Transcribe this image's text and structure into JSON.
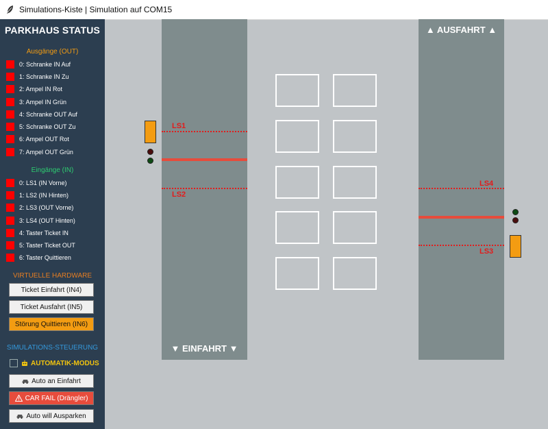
{
  "window": {
    "title": "Simulations-Kiste | Simulation auf COM15"
  },
  "sidebar": {
    "heading": "PARKHAUS STATUS",
    "outputs_title": "Ausgänge (OUT)",
    "outputs": [
      {
        "label": "0: Schranke IN Auf"
      },
      {
        "label": "1: Schranke IN Zu"
      },
      {
        "label": "2: Ampel IN Rot"
      },
      {
        "label": "3: Ampel IN Grün"
      },
      {
        "label": "4: Schranke OUT Auf"
      },
      {
        "label": "5: Schranke OUT Zu"
      },
      {
        "label": "6: Ampel OUT Rot"
      },
      {
        "label": "7: Ampel OUT Grün"
      }
    ],
    "inputs_title": "Eingänge (IN)",
    "inputs": [
      {
        "label": "0: LS1 (IN Vorne)"
      },
      {
        "label": "1: LS2 (IN Hinten)"
      },
      {
        "label": "2: LS3 (OUT Vorne)"
      },
      {
        "label": "3: LS4 (OUT Hinten)"
      },
      {
        "label": "4: Taster Ticket IN"
      },
      {
        "label": "5: Taster Ticket OUT"
      },
      {
        "label": "6: Taster Quittieren"
      }
    ],
    "hardware_title": "VIRTUELLE HARDWARE",
    "hardware_buttons": {
      "ticket_in": "Ticket Einfahrt (IN4)",
      "ticket_out": "Ticket Ausfahrt (IN5)",
      "ack": "Störung Quittieren (IN6)"
    },
    "simulation_title": "SIMULATIONS-STEUERUNG",
    "auto_mode_label": "AUTOMATIK-MODUS",
    "sim_buttons": {
      "car_in": "Auto an Einfahrt",
      "car_fail": "CAR FAIL (Drängler)",
      "car_out": "Auto will Ausparken"
    },
    "icons": {
      "car_in": "car-icon",
      "car_fail": "warning-icon",
      "car_out": "car-icon",
      "auto_mode": "robot-icon"
    }
  },
  "scene": {
    "entry_label": "▼ EINFAHRT ▼",
    "exit_label": "▲ AUSFAHRT ▲",
    "sensors": {
      "ls1": "LS1",
      "ls2": "LS2",
      "ls3": "LS3",
      "ls4": "LS4"
    },
    "parking_slots": 10
  },
  "colors": {
    "sidebar_bg": "#2c3e50",
    "output_section": "#f39c12",
    "input_section": "#2ecc71",
    "hardware_section": "#e67e22",
    "simulation_section": "#3498db",
    "auto_mode": "#f1c40f",
    "led_inactive": "#ff0000",
    "lane": "#7f8c8d",
    "sensor": "#e31b1b",
    "barrier": "#f39c12",
    "light_red": "#4a0d0d",
    "light_green": "#0d4a14"
  }
}
